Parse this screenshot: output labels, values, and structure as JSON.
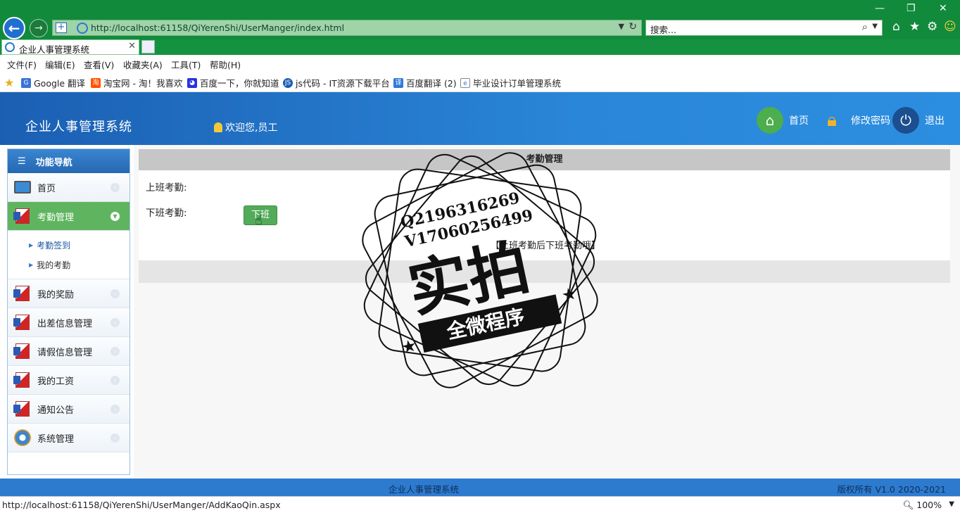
{
  "browser": {
    "url": "http://localhost:61158/QiYerenShi/UserManger/index.html",
    "search_placeholder": "搜索...",
    "tab_title": "企业人事管理系统",
    "menu": [
      "文件(F)",
      "编辑(E)",
      "查看(V)",
      "收藏夹(A)",
      "工具(T)",
      "帮助(H)"
    ],
    "favorites": [
      {
        "label": "Google 翻译",
        "icon": "google-translate-icon",
        "color": "#3b73d6"
      },
      {
        "label": "淘宝网 - 淘！我喜欢",
        "icon": "taobao-icon",
        "color": "#ff5400"
      },
      {
        "label": "百度一下，你就知道",
        "icon": "baidu-paw-icon",
        "color": "#2932e1"
      },
      {
        "label": "js代码 - IT资源下载平台",
        "icon": "js-icon",
        "color": "#1a5fb4"
      },
      {
        "label": "百度翻译 (2)",
        "icon": "baidu-translate-icon",
        "color": "#2f7bd8"
      },
      {
        "label": "毕业设计订单管理系统",
        "icon": "ie-page-icon",
        "color": "#888888"
      }
    ],
    "status_url": "http://localhost:61158/QiYerenShi/UserManger/AddKaoQin.aspx",
    "zoom": "100%"
  },
  "header": {
    "title": "企业人事管理系统",
    "welcome": "欢迎您,员工",
    "home_label": "首页",
    "password_label": "修改密码",
    "logout_label": "退出"
  },
  "sidebar": {
    "title": "功能导航",
    "items": [
      {
        "label": "首页"
      },
      {
        "label": "考勤管理",
        "sub": [
          "考勤签到",
          "我的考勤"
        ]
      },
      {
        "label": "我的奖励"
      },
      {
        "label": "出差信息管理"
      },
      {
        "label": "请假信息管理"
      },
      {
        "label": "我的工资"
      },
      {
        "label": "通知公告"
      },
      {
        "label": "系统管理"
      }
    ]
  },
  "main": {
    "panel_title": "考勤管理",
    "checkin_label": "上班考勤:",
    "checkout_label": "下班考勤:",
    "checkout_button": "下班",
    "notice": "【上班考勤后下班考勤哦】"
  },
  "watermark": {
    "line1": "Q2196316269",
    "line2": "V17060256499",
    "big": "实拍",
    "ribbon": "全微程序"
  },
  "footer": {
    "center": "企业人事管理系统",
    "right": "版权所有 V1.0 2020-2021"
  },
  "colors": {
    "browser_green": "#118a3c",
    "header_blue": "#2a86d8",
    "active_green": "#5fb55f"
  }
}
